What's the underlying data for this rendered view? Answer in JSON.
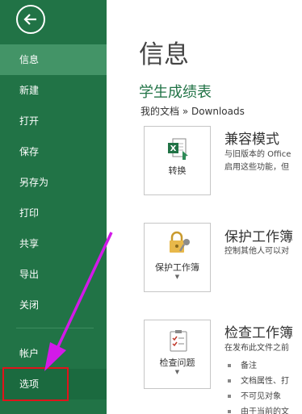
{
  "sidebar": {
    "items": [
      {
        "label": "信息"
      },
      {
        "label": "新建"
      },
      {
        "label": "打开"
      },
      {
        "label": "保存"
      },
      {
        "label": "另存为"
      },
      {
        "label": "打印"
      },
      {
        "label": "共享"
      },
      {
        "label": "导出"
      },
      {
        "label": "关闭"
      },
      {
        "label": "帐户"
      },
      {
        "label": "选项"
      }
    ]
  },
  "main": {
    "title": "信息",
    "doc_title": "学生成绩表",
    "breadcrumb": "我的文档 » Downloads",
    "sections": [
      {
        "button_label": "转换",
        "title": "兼容模式",
        "desc_lines": [
          "与旧版本的 Office",
          "启用这些功能，但"
        ]
      },
      {
        "button_label": "保护工作簿",
        "title": "保护工作簿",
        "desc_lines": [
          "控制其他人可以对"
        ]
      },
      {
        "button_label": "检查问题",
        "title": "检查工作簿",
        "desc_lines": [
          "在发布此文件之前"
        ],
        "bullets": [
          "备注",
          "文档属性、打",
          "不可见对象",
          "由于当前的文"
        ]
      }
    ]
  },
  "colors": {
    "sidebar_bg": "#217346",
    "active_item_bg": "#439467",
    "annotation_red": "#e0141b",
    "annotation_arrow": "#d21ae8"
  },
  "icons": {
    "back": "back-arrow-icon",
    "convert": "excel-convert-icon",
    "protect": "lock-key-icon",
    "inspect": "checklist-icon"
  }
}
